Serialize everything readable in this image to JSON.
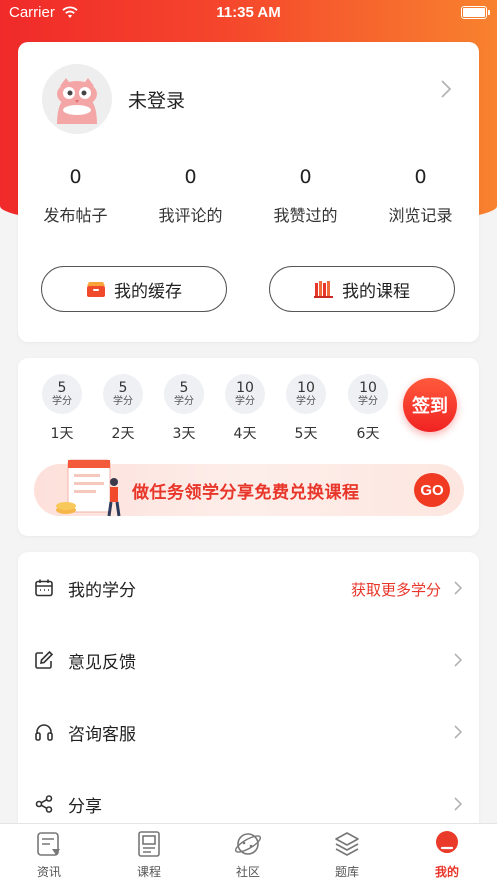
{
  "status_bar": {
    "carrier": "Carrier",
    "time": "11:35 AM"
  },
  "profile": {
    "username": "未登录",
    "stats": [
      {
        "value": "0",
        "label": "发布帖子"
      },
      {
        "value": "0",
        "label": "我评论的"
      },
      {
        "value": "0",
        "label": "我赞过的"
      },
      {
        "value": "0",
        "label": "浏览记录"
      }
    ],
    "buttons": {
      "cache": "我的缓存",
      "courses": "我的课程"
    }
  },
  "checkin": {
    "days": [
      {
        "points": "5",
        "unit": "学分",
        "label": "1天"
      },
      {
        "points": "5",
        "unit": "学分",
        "label": "2天"
      },
      {
        "points": "5",
        "unit": "学分",
        "label": "3天"
      },
      {
        "points": "10",
        "unit": "学分",
        "label": "4天"
      },
      {
        "points": "10",
        "unit": "学分",
        "label": "5天"
      },
      {
        "points": "10",
        "unit": "学分",
        "label": "6天"
      }
    ],
    "button": "签到",
    "banner_text": "做任务领学分享免费兑换课程",
    "banner_go": "GO"
  },
  "menu": {
    "credits": {
      "label": "我的学分",
      "extra": "获取更多学分"
    },
    "feedback": {
      "label": "意见反馈"
    },
    "service": {
      "label": "咨询客服"
    },
    "share": {
      "label": "分享"
    }
  },
  "tabbar": {
    "items": [
      {
        "label": "资讯",
        "icon": "news-icon"
      },
      {
        "label": "课程",
        "icon": "course-icon"
      },
      {
        "label": "社区",
        "icon": "community-icon"
      },
      {
        "label": "题库",
        "icon": "question-bank-icon"
      },
      {
        "label": "我的",
        "icon": "profile-icon"
      }
    ],
    "active_index": 4
  },
  "colors": {
    "accent": "#e8362a",
    "gradient_start": "#f02a2a",
    "gradient_end": "#f8822e"
  }
}
